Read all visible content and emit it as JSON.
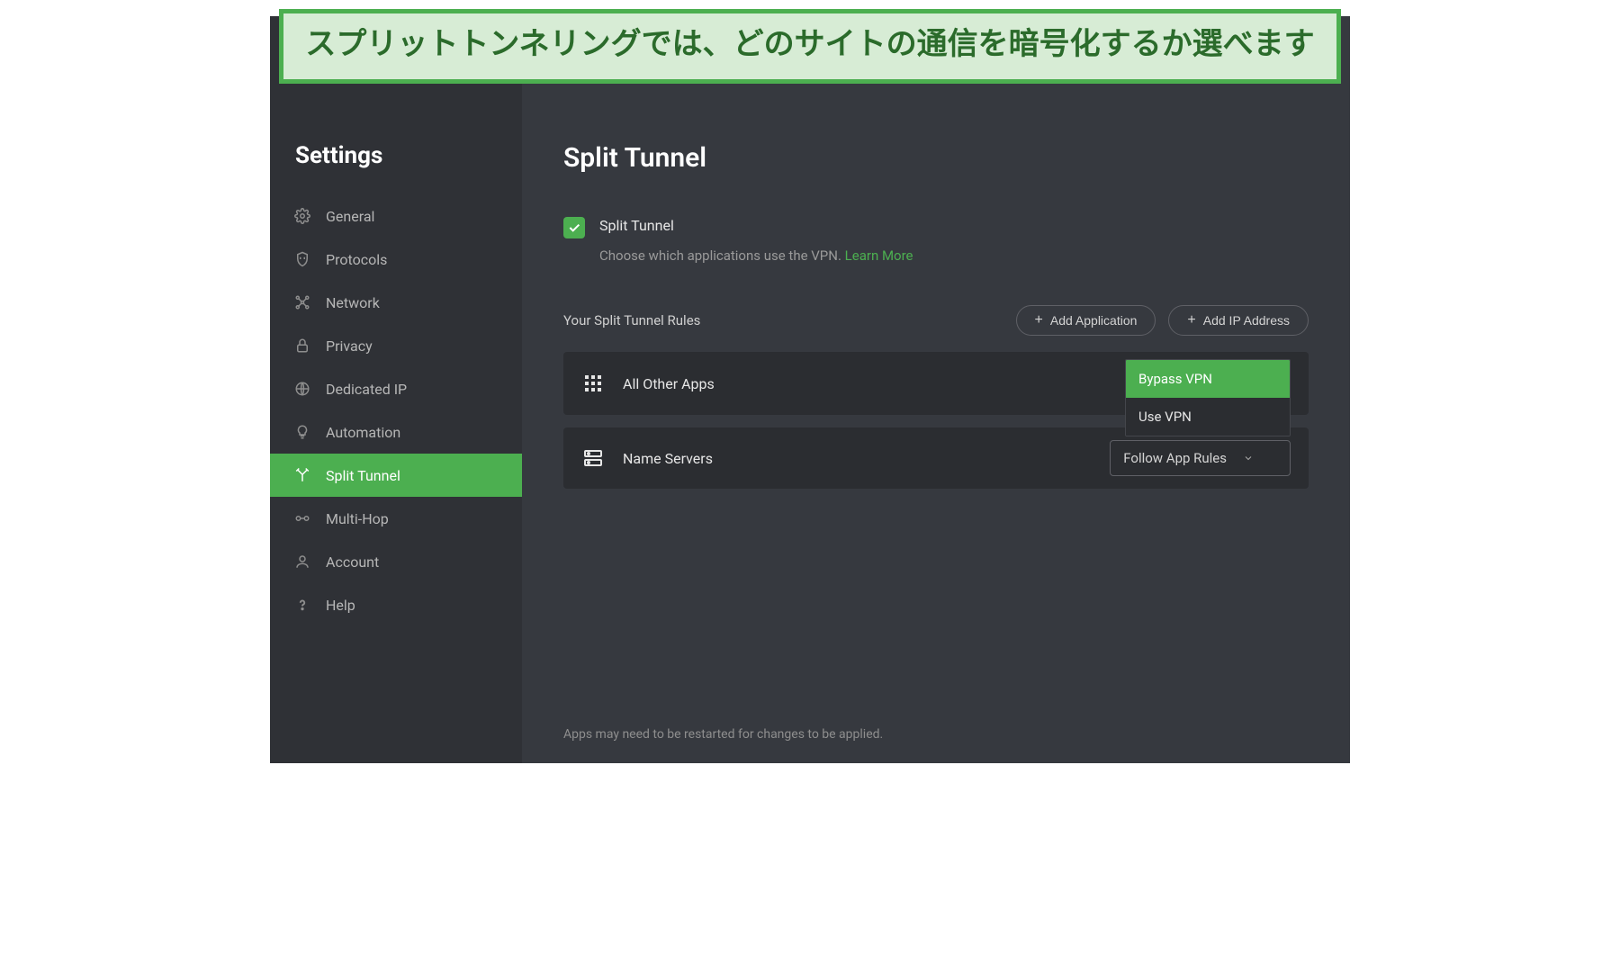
{
  "callout": {
    "text": "スプリットトンネリングでは、どのサイトの通信を暗号化するか選べます"
  },
  "sidebar": {
    "title": "Settings",
    "items": [
      {
        "label": "General",
        "active": false
      },
      {
        "label": "Protocols",
        "active": false
      },
      {
        "label": "Network",
        "active": false
      },
      {
        "label": "Privacy",
        "active": false
      },
      {
        "label": "Dedicated IP",
        "active": false
      },
      {
        "label": "Automation",
        "active": false
      },
      {
        "label": "Split Tunnel",
        "active": true
      },
      {
        "label": "Multi-Hop",
        "active": false
      },
      {
        "label": "Account",
        "active": false
      },
      {
        "label": "Help",
        "active": false
      }
    ]
  },
  "main": {
    "title": "Split Tunnel",
    "toggle_label": "Split Tunnel",
    "toggle_subtext": "Choose which applications use the VPN.",
    "learn_more": "Learn More",
    "rules_title": "Your Split Tunnel Rules",
    "add_app_label": "Add Application",
    "add_ip_label": "Add IP Address",
    "rules": [
      {
        "label": "All Other Apps",
        "select_value": "Bypass VPN"
      },
      {
        "label": "Name Servers",
        "select_value": "Follow App Rules"
      }
    ],
    "dropdown": {
      "options": [
        {
          "label": "Bypass VPN",
          "selected": true
        },
        {
          "label": "Use VPN",
          "selected": false
        }
      ]
    },
    "footer": "Apps may need to be restarted for changes to be applied."
  },
  "colors": {
    "accent": "#4caf50",
    "bg_dark": "#36393f",
    "bg_darker": "#2f3136",
    "row_bg": "#2b2d31"
  }
}
